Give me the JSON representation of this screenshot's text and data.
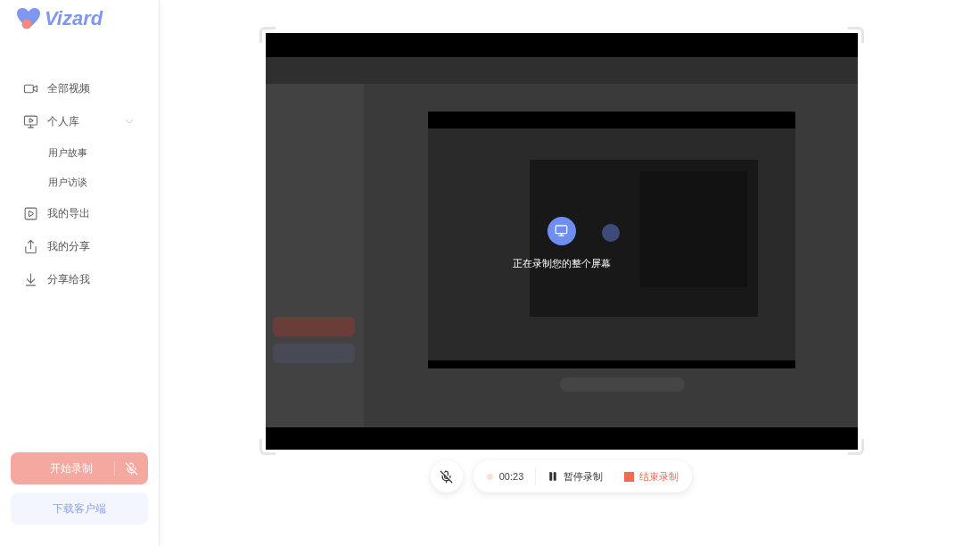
{
  "logo": {
    "text": "Vizard"
  },
  "nav": [
    {
      "kind": "item",
      "label": "全部视频"
    },
    {
      "kind": "group",
      "label": "个人库",
      "expanded": true,
      "children": [
        {
          "label": "用户故事"
        },
        {
          "label": "用户访谈"
        }
      ]
    },
    {
      "kind": "item",
      "label": "我的导出"
    },
    {
      "kind": "item",
      "label": "我的分享"
    },
    {
      "kind": "item",
      "label": "分享给我"
    }
  ],
  "record_button": {
    "label": "开始录制",
    "mic_muted": true
  },
  "download_button": {
    "label": "下载客户端"
  },
  "preview": {
    "kind": "picture",
    "overlay": "正在录制您的整个屏幕"
  },
  "controls": {
    "mic_muted": true,
    "timer": "00:23",
    "pause": "暂停录制",
    "stop": "结束录制"
  }
}
